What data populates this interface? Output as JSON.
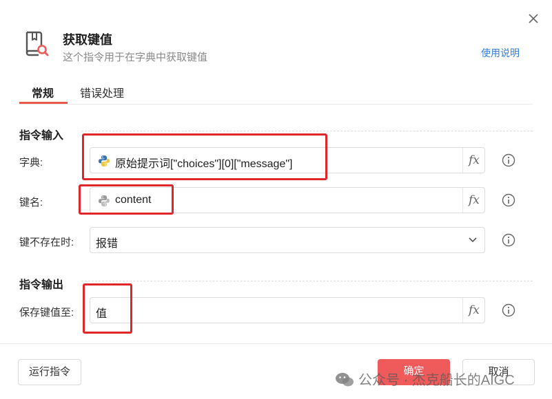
{
  "dialog": {
    "title": "获取键值",
    "subtitle": "这个指令用于在字典中获取键值",
    "help_link": "使用说明"
  },
  "tabs": [
    {
      "label": "常规",
      "active": true
    },
    {
      "label": "错误处理",
      "active": false
    }
  ],
  "input_section": {
    "title": "指令输入",
    "rows": [
      {
        "label": "字典:",
        "value": "原始提示词[\"choices\"][0][\"message\"]",
        "fx": "fx"
      },
      {
        "label": "键名:",
        "value": "content",
        "fx": "fx"
      },
      {
        "label": "键不存在时:",
        "value": "报错"
      }
    ]
  },
  "output_section": {
    "title": "指令输出",
    "rows": [
      {
        "label": "保存键值至:",
        "value": "值",
        "fx": "fx"
      }
    ]
  },
  "footer": {
    "run_button": "运行指令",
    "ok_button": "确定",
    "cancel_button": "取消"
  },
  "watermark": {
    "text": "公众号 · 杰克船长的AIGC"
  },
  "colors": {
    "accent": "#ef5a5a",
    "link": "#2f7ee0",
    "highlight_box": "#e0252a"
  },
  "icons": {
    "close": "close-icon",
    "header": "book-search-icon",
    "python": "python-icon",
    "info": "info-icon",
    "dropdown": "chevron-down-icon",
    "watermark": "wechat-icon"
  }
}
